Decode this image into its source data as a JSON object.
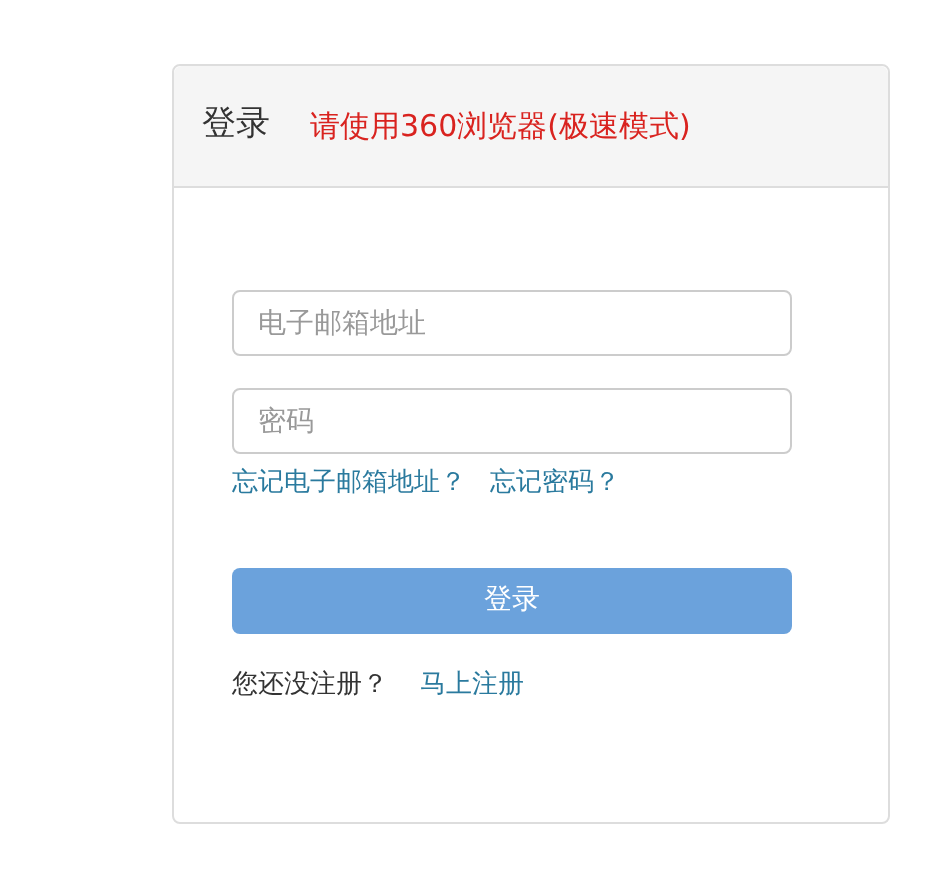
{
  "panel": {
    "title": "登录",
    "notice": "请使用360浏览器(极速模式)"
  },
  "fields": [
    {
      "placeholder": "电子邮箱地址"
    },
    {
      "placeholder": "密码"
    }
  ],
  "links": [
    "忘记电子邮箱地址？",
    "忘记密码？"
  ],
  "submit": {
    "label": "登录",
    "disabled": true
  },
  "register": {
    "prompt": "您还没注册？",
    "link": "马上注册"
  }
}
